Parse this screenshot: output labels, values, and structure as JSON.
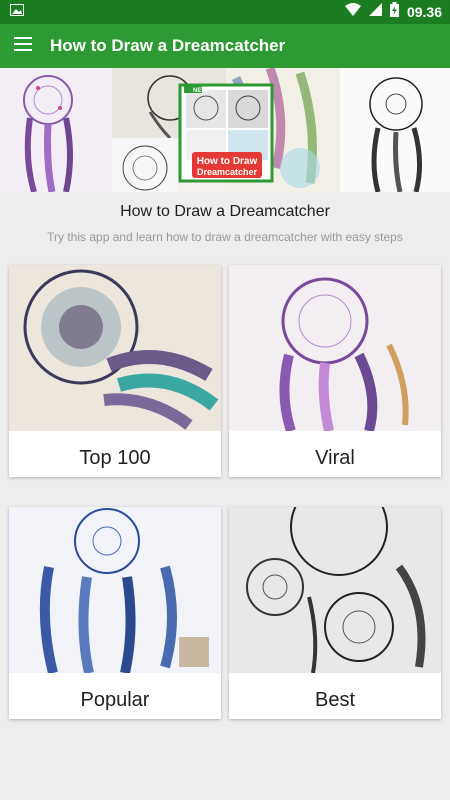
{
  "status_bar": {
    "time": "09.36"
  },
  "app_bar": {
    "title": "How to Draw a Dreamcatcher"
  },
  "banner": {
    "badge": "NEW",
    "logo_line1": "How to Draw",
    "logo_line2": "Dreamcatcher"
  },
  "heading": {
    "title": "How to Draw a Dreamcatcher",
    "subtitle": "Try this app and learn how to draw a dreamcatcher with easy steps"
  },
  "cards": [
    {
      "label": "Top 100"
    },
    {
      "label": "Viral"
    },
    {
      "label": "Popular"
    },
    {
      "label": "Best"
    }
  ],
  "colors": {
    "status_bar": "#1b7d1f",
    "app_bar": "#2e9a34",
    "background": "#ededed"
  }
}
